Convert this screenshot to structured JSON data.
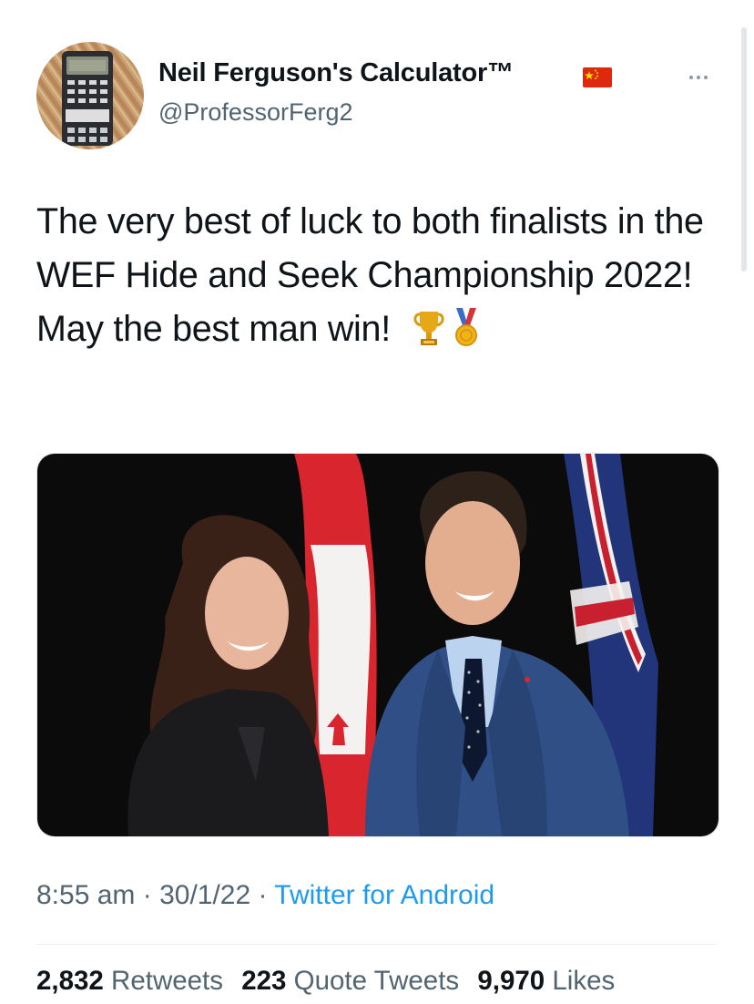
{
  "author": {
    "display_name": "Neil Ferguson's Calculator™",
    "handle": "@ProfessorFerg2",
    "badge_icon": "china-flag-icon",
    "avatar_icon": "calculator-icon"
  },
  "tweet": {
    "text": "The very best of luck to both finalists in the WEF Hide and Seek Championship 2022! May the best man win!",
    "emojis": [
      "trophy-icon",
      "medal-icon"
    ],
    "image_description_icon": "photo-two-people-flags"
  },
  "meta": {
    "time": "8:55 am",
    "sep1": " · ",
    "date": "30/1/22",
    "sep2": " · ",
    "source": "Twitter for Android"
  },
  "stats": {
    "retweets_count": "2,832",
    "retweets_label": "Retweets",
    "quotes_count": "223",
    "quotes_label": "Quote Tweets",
    "likes_count": "9,970",
    "likes_label": "Likes"
  },
  "colors": {
    "link": "#1d9bf0",
    "secondary_text": "#536471",
    "primary_text": "#0f1419"
  }
}
